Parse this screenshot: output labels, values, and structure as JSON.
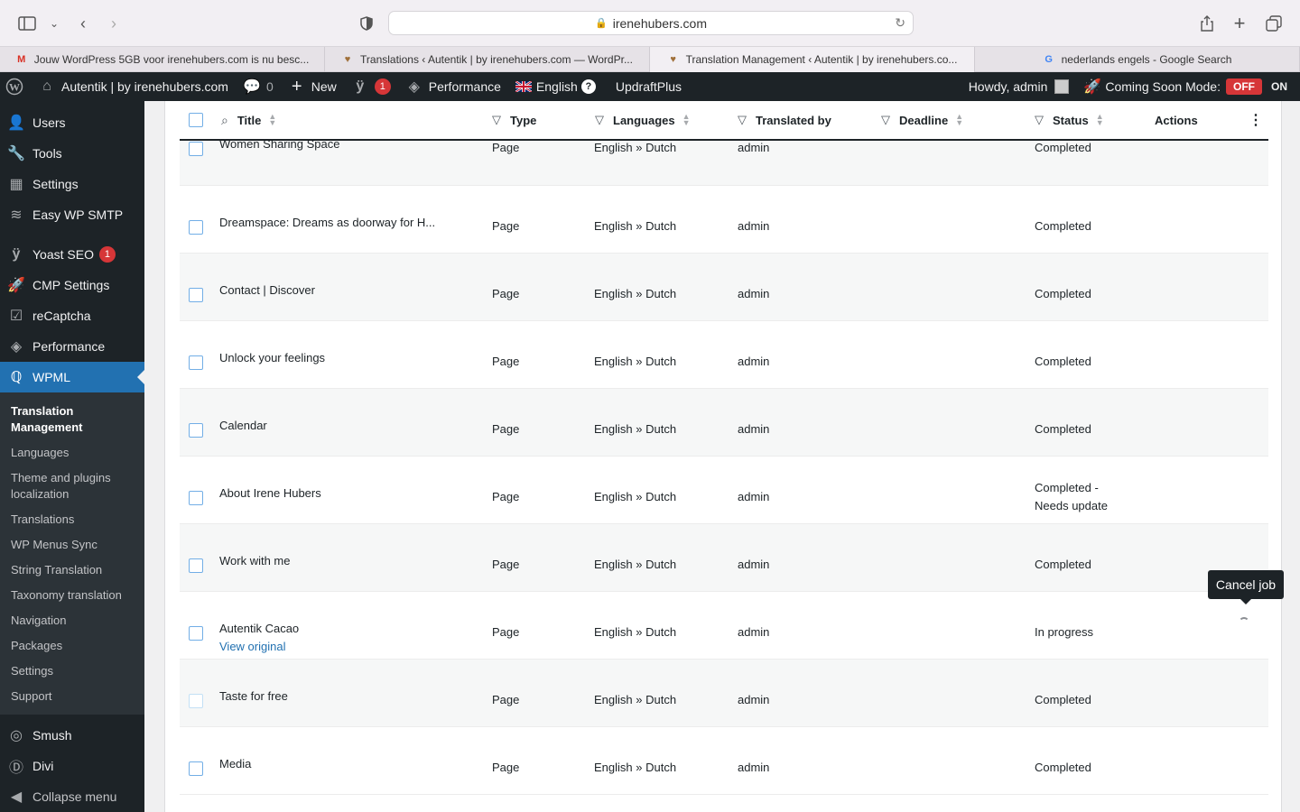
{
  "browser": {
    "url": "irenehubers.com",
    "tabs": [
      {
        "label": "Jouw WordPress 5GB voor irenehubers.com is nu besc...",
        "icon": "gmail-icon",
        "active": false
      },
      {
        "label": "Translations ‹ Autentik | by irenehubers.com — WordPr...",
        "icon": "heart-icon",
        "active": false
      },
      {
        "label": "Translation Management ‹ Autentik | by irenehubers.co...",
        "icon": "heart-icon",
        "active": true
      },
      {
        "label": "nederlands engels - Google Search",
        "icon": "google-icon",
        "active": false
      }
    ]
  },
  "adminbar": {
    "site_name": "Autentik | by irenehubers.com",
    "comments_count": "0",
    "new_label": "New",
    "yoast_badge": "1",
    "performance_label": "Performance",
    "language_label": "English",
    "updraft_label": "UpdraftPlus",
    "howdy": "Howdy, admin",
    "coming_soon_label": "Coming Soon Mode:",
    "off_label": "OFF",
    "on_label": "ON"
  },
  "sidebar": {
    "items_top": [
      {
        "label": "Users",
        "icon": "users-icon"
      },
      {
        "label": "Tools",
        "icon": "wrench-icon"
      },
      {
        "label": "Settings",
        "icon": "settings-sliders-icon"
      },
      {
        "label": "Easy WP SMTP",
        "icon": "mail-stack-icon"
      }
    ],
    "yoast_label": "Yoast SEO",
    "yoast_badge": "1",
    "cmp_label": "CMP Settings",
    "recaptcha_label": "reCaptcha",
    "performance_label": "Performance",
    "wpml_label": "WPML",
    "submenu": [
      "Translation Management",
      "Languages",
      "Theme and plugins localization",
      "Translations",
      "WP Menus Sync",
      "String Translation",
      "Taxonomy translation",
      "Navigation",
      "Packages",
      "Settings",
      "Support"
    ],
    "smush_label": "Smush",
    "divi_label": "Divi",
    "collapse_label": "Collapse menu"
  },
  "table": {
    "headers": {
      "title": "Title",
      "type": "Type",
      "languages": "Languages",
      "translated_by": "Translated by",
      "deadline": "Deadline",
      "status": "Status",
      "actions": "Actions"
    },
    "rows": [
      {
        "title": "Women Sharing Space",
        "type": "Page",
        "languages": "English » Dutch",
        "translated_by": "admin",
        "status": "Completed",
        "status2": ""
      },
      {
        "title": "Dreamspace: Dreams as doorway for H...",
        "type": "Page",
        "languages": "English » Dutch",
        "translated_by": "admin",
        "status": "Completed",
        "status2": ""
      },
      {
        "title": "Contact | Discover",
        "type": "Page",
        "languages": "English » Dutch",
        "translated_by": "admin",
        "status": "Completed",
        "status2": ""
      },
      {
        "title": "Unlock your feelings",
        "type": "Page",
        "languages": "English » Dutch",
        "translated_by": "admin",
        "status": "Completed",
        "status2": ""
      },
      {
        "title": "Calendar",
        "type": "Page",
        "languages": "English » Dutch",
        "translated_by": "admin",
        "status": "Completed",
        "status2": ""
      },
      {
        "title": "About Irene Hubers",
        "type": "Page",
        "languages": "English » Dutch",
        "translated_by": "admin",
        "status": "Completed -",
        "status2": "Needs update"
      },
      {
        "title": "Work with me",
        "type": "Page",
        "languages": "English » Dutch",
        "translated_by": "admin",
        "status": "Completed",
        "status2": ""
      },
      {
        "title": "Autentik Cacao",
        "type": "Page",
        "languages": "English » Dutch",
        "translated_by": "admin",
        "status": "In progress",
        "status2": "",
        "link": "View original"
      },
      {
        "title": "Taste for free",
        "type": "Page",
        "languages": "English » Dutch",
        "translated_by": "admin",
        "status": "Completed",
        "status2": ""
      },
      {
        "title": "Media",
        "type": "Page",
        "languages": "English » Dutch",
        "translated_by": "admin",
        "status": "Completed",
        "status2": ""
      }
    ]
  },
  "tooltip": "Cancel job",
  "colors": {
    "admin_dark": "#1d2327",
    "wp_blue": "#2271b1",
    "badge_red": "#d63638"
  }
}
